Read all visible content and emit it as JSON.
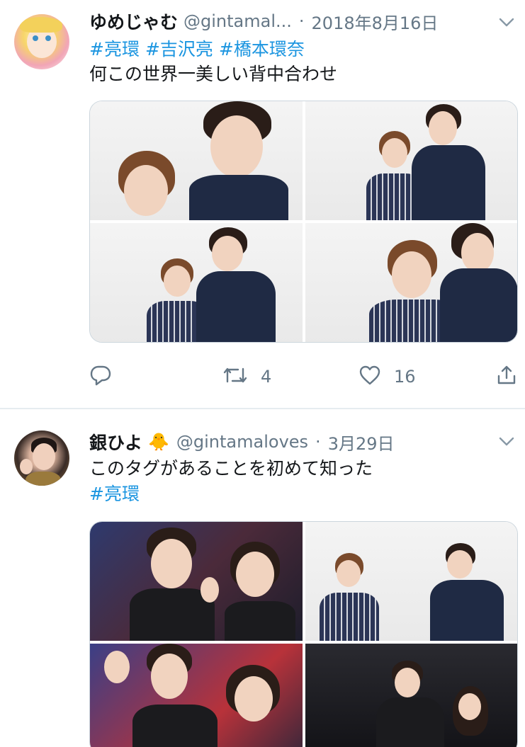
{
  "tweets": [
    {
      "display_name": "ゆめじゃむ",
      "handle": "@gintamal...",
      "separator": "·",
      "date": "2018年8月16日",
      "hashtags": [
        "#亮環",
        "#吉沢亮",
        "#橋本環奈"
      ],
      "text": "何この世界一美しい背中合わせ",
      "retweet_count": "4",
      "like_count": "16"
    },
    {
      "display_name": "銀ひよ",
      "emoji": "🐥",
      "handle": "@gintamaloves",
      "separator": "·",
      "date": "3月29日",
      "text": "このタグがあることを初めて知った",
      "hashtags": [
        "#亮環"
      ]
    }
  ],
  "icons": {
    "chevron": "chevron-down-icon",
    "reply": "reply-icon",
    "retweet": "retweet-icon",
    "like": "heart-icon",
    "share": "share-icon"
  },
  "colors": {
    "link": "#1b95e0",
    "secondary_text": "#657786",
    "divider": "#e6ecf0"
  }
}
